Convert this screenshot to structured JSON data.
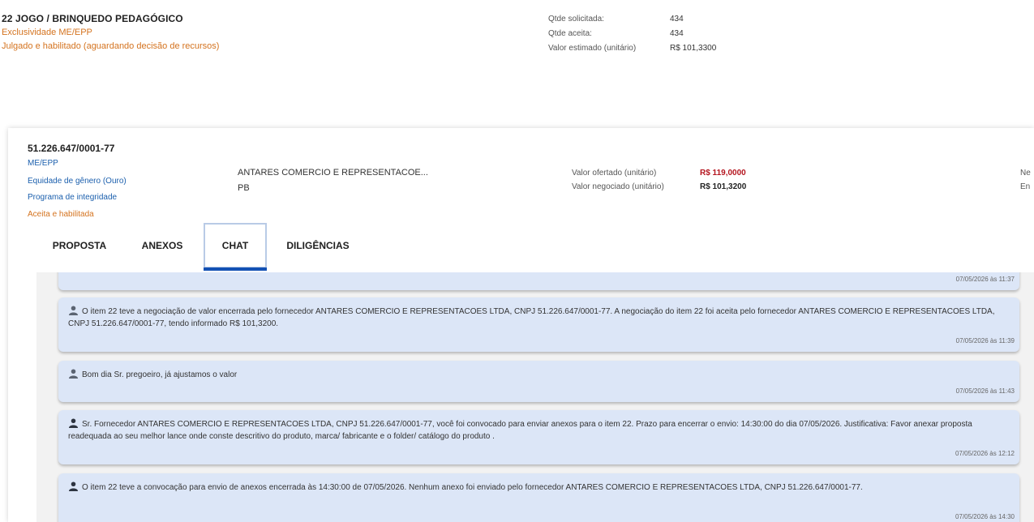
{
  "item": {
    "title": "22  JOGO / BRINQUEDO PEDAGÓGICO",
    "exclusivity": "Exclusividade ME/EPP",
    "status": "Julgado e habilitado (aguardando decisão de recursos)",
    "qty_requested_label": "Qtde solicitada:",
    "qty_requested_value": "434",
    "qty_accepted_label": "Qtde aceita:",
    "qty_accepted_value": "434",
    "estimated_label": "Valor estimado (unitário)",
    "estimated_value": "R$ 101,3300"
  },
  "proposal": {
    "cnpj": "51.226.647/0001-77",
    "tags": [
      "ME/EPP",
      "Equidade de gênero (Ouro)",
      "Programa de integridade"
    ],
    "acceptance": "Aceita e habilitada",
    "supplier_name": "ANTARES COMERCIO E REPRESENTACOE...",
    "supplier_uf": "PB",
    "offered_label": "Valor ofertado (unitário)",
    "offered_value": "R$ 119,0000",
    "negotiated_label": "Valor negociado (unitário)",
    "negotiated_value": "R$ 101,3200",
    "clipped_1": "Ne",
    "clipped_2": "En"
  },
  "tabs": [
    {
      "label": "PROPOSTA"
    },
    {
      "label": "ANEXOS"
    },
    {
      "label": "CHAT"
    },
    {
      "label": "DILIGÊNCIAS"
    }
  ],
  "chat": {
    "partial_timestamp": "07/05/2026 às 11:37",
    "messages": [
      {
        "text": "O item 22 teve a negociação de valor encerrada pelo fornecedor ANTARES COMERCIO E REPRESENTACOES LTDA, CNPJ 51.226.647/0001-77. A negociação do item 22 foi aceita pelo fornecedor ANTARES COMERCIO E REPRESENTACOES LTDA, CNPJ 51.226.647/0001-77, tendo informado R$ 101,3200.",
        "timestamp": "07/05/2026 às 11:39"
      },
      {
        "text": "Bom dia Sr. pregoeiro, já ajustamos o valor",
        "timestamp": "07/05/2026 às 11:43"
      },
      {
        "text": "Sr. Fornecedor ANTARES COMERCIO E REPRESENTACOES LTDA, CNPJ 51.226.647/0001-77, você foi convocado para enviar anexos para o item 22. Prazo para encerrar o envio: 14:30:00 do dia 07/05/2026. Justificativa: Favor anexar proposta readequada ao seu melhor lance onde conste descritivo do produto, marca/ fabricante e o folder/ catálogo do produto .",
        "timestamp": "07/05/2026 às 12:12"
      },
      {
        "text": "O item 22 teve a convocação para envio de anexos encerrada às 14:30:00 de 07/05/2026. Nenhum anexo foi enviado pelo fornecedor ANTARES COMERCIO E REPRESENTACOES LTDA, CNPJ 51.226.647/0001-77.",
        "timestamp": "07/05/2026 às 14:30"
      }
    ]
  },
  "colors": {
    "accent_blue": "#1351b4",
    "warning_orange": "#d4731f",
    "offered_red": "#b4141e",
    "message_bg": "#dce6f7"
  },
  "icons": {
    "message_sender": "user-icon"
  }
}
